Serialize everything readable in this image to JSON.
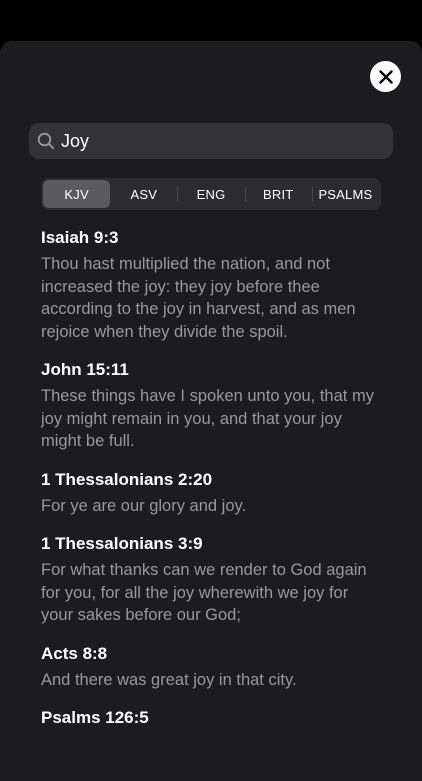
{
  "search": {
    "value": "Joy",
    "placeholder": "Search"
  },
  "tabs": [
    {
      "label": "KJV",
      "selected": true
    },
    {
      "label": "ASV",
      "selected": false
    },
    {
      "label": "ENG",
      "selected": false
    },
    {
      "label": "BRIT",
      "selected": false
    },
    {
      "label": "PSALMS",
      "selected": false
    }
  ],
  "results": [
    {
      "reference": "Isaiah 9:3",
      "text": "Thou hast multiplied the nation, and  not increased the joy: they joy before thee according to the joy in harvest,  and  as men  rejoice when they divide the spoil."
    },
    {
      "reference": "John 15:11",
      "text": "These things have I spoken unto you, that my joy might remain in you, and that  your joy might be full."
    },
    {
      "reference": "1 Thessalonians 2:20",
      "text": "For ye are our glory and joy."
    },
    {
      "reference": "1 Thessalonians 3:9",
      "text": "For what thanks can we render to God again for you, for all the joy wherewith we joy for your sakes before our God;"
    },
    {
      "reference": "Acts 8:8",
      "text": "And there was great joy in that city."
    },
    {
      "reference": "Psalms 126:5",
      "text": ""
    }
  ],
  "icons": {
    "close": "close-icon",
    "search": "search-icon"
  },
  "colors": {
    "background": "#000000",
    "sheet": "#1c1c1e",
    "search_field": "#333336",
    "segment_track": "#2c2c2e",
    "segment_active": "#5b5b5f",
    "verse_text": "#98989d"
  }
}
